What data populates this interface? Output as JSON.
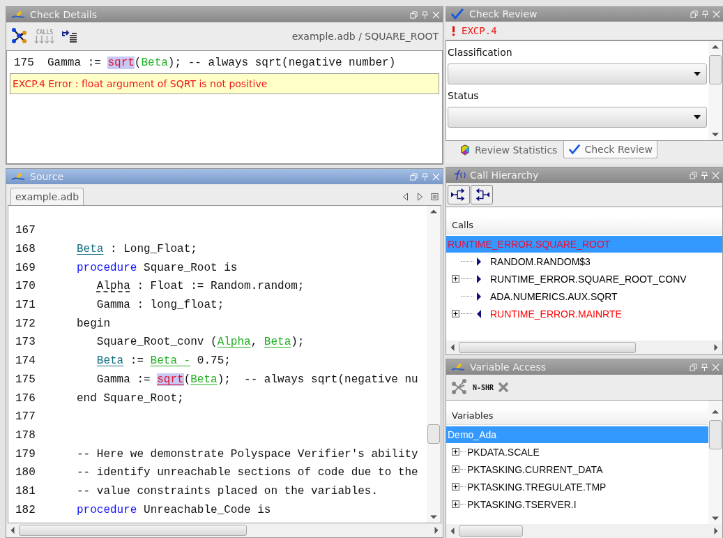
{
  "check_details": {
    "title": "Check Details",
    "active": false,
    "toolbar_label": "CALLS",
    "location": "example.adb / SQUARE_ROOT",
    "code_line": {
      "number": "175",
      "segments": [
        {
          "text": "Gamma := ",
          "kind": "plain"
        },
        {
          "text": "sqrt",
          "kind": "error"
        },
        {
          "text": "(",
          "kind": "plain"
        },
        {
          "text": "Beta",
          "kind": "used"
        },
        {
          "text": "); -- always sqrt(negative number)",
          "kind": "plain"
        }
      ]
    },
    "message": "EXCP.4 Error : float argument of SQRT is not positive"
  },
  "check_review": {
    "title": "Check Review",
    "active": false,
    "check": "EXCP.4",
    "fields": [
      {
        "label": "Classification"
      },
      {
        "label": "Status"
      }
    ],
    "tabs": [
      {
        "label": "Review Statistics",
        "selected": false,
        "kind": "stats"
      },
      {
        "label": "Check Review",
        "selected": true,
        "kind": "review"
      }
    ]
  },
  "source": {
    "title": "Source",
    "active": true,
    "tabs": [
      {
        "label": "example.adb",
        "selected": true
      }
    ],
    "lines": [
      {
        "number": "167"
      },
      {
        "number": "168",
        "segments": [
          {
            "text": "Beta",
            "kind": "declared"
          },
          {
            "text": " : Long_Float;",
            "kind": "plain"
          }
        ]
      },
      {
        "number": "169",
        "segments": [
          {
            "text": "procedure",
            "kind": "keyword"
          },
          {
            "text": " Square_Root is",
            "kind": "plain"
          }
        ]
      },
      {
        "number": "170",
        "indented": true,
        "segments": [
          {
            "text": "Alpha",
            "kind": "uninit"
          },
          {
            "text": " : Float := Random.random;",
            "kind": "plain"
          }
        ]
      },
      {
        "number": "171",
        "indented": true,
        "segments": [
          {
            "text": "Gamma : long_float;",
            "kind": "plain"
          }
        ]
      },
      {
        "number": "172",
        "segments": [
          {
            "text": "begin",
            "kind": "plain"
          }
        ]
      },
      {
        "number": "173",
        "indented": true,
        "segments": [
          {
            "text": "Square_Root_conv (",
            "kind": "plain"
          },
          {
            "text": "Alpha",
            "kind": "used"
          },
          {
            "text": ", ",
            "kind": "plain"
          },
          {
            "text": "Beta",
            "kind": "used"
          },
          {
            "text": ");",
            "kind": "plain"
          }
        ]
      },
      {
        "number": "174",
        "indented": true,
        "segments": [
          {
            "text": "Beta",
            "kind": "declared"
          },
          {
            "text": " := ",
            "kind": "plain"
          },
          {
            "text": "Beta -",
            "kind": "used"
          },
          {
            "text": " 0.75;",
            "kind": "plain"
          }
        ]
      },
      {
        "number": "175",
        "indented": true,
        "segments": [
          {
            "text": "Gamma := ",
            "kind": "plain"
          },
          {
            "text": "sqrt",
            "kind": "error"
          },
          {
            "text": "(",
            "kind": "plain"
          },
          {
            "text": "Beta",
            "kind": "used"
          },
          {
            "text": ");  -- always sqrt(negative nu",
            "kind": "plain"
          }
        ]
      },
      {
        "number": "176",
        "segments": [
          {
            "text": "end Square_Root;",
            "kind": "plain"
          }
        ]
      },
      {
        "number": "177"
      },
      {
        "number": "178"
      },
      {
        "number": "179",
        "segments": [
          {
            "text": "-- Here we demonstrate Polyspace Verifier's ability",
            "kind": "plain"
          }
        ]
      },
      {
        "number": "180",
        "segments": [
          {
            "text": "-- identify unreachable sections of code due to the",
            "kind": "plain"
          }
        ]
      },
      {
        "number": "181",
        "segments": [
          {
            "text": "-- value constraints placed on the variables.",
            "kind": "plain"
          }
        ]
      },
      {
        "number": "182",
        "segments": [
          {
            "text": "procedure",
            "kind": "keyword"
          },
          {
            "text": " Unreachable_Code is",
            "kind": "plain"
          }
        ]
      }
    ]
  },
  "call_hierarchy": {
    "title": "Call Hierarchy",
    "active": false,
    "column": "Calls",
    "root": {
      "label": "RUNTIME_ERROR.SQUARE_ROOT",
      "selected": true,
      "color": "#e8103c",
      "children": [
        {
          "label": "RANDOM.RANDOM$3",
          "has_children": false,
          "kind": "callee",
          "color": "#000000"
        },
        {
          "label": "RUNTIME_ERROR.SQUARE_ROOT_CONV",
          "has_children": true,
          "kind": "callee",
          "color": "#000000"
        },
        {
          "label": "ADA.NUMERICS.AUX.SQRT",
          "has_children": false,
          "kind": "callee",
          "color": "#000000"
        },
        {
          "label": "RUNTIME_ERROR.MAINRTE",
          "has_children": true,
          "kind": "caller",
          "color": "#ff0000"
        }
      ]
    }
  },
  "variable_access": {
    "title": "Variable Access",
    "active": false,
    "toolbar_label": "N-SHR",
    "column": "Variables",
    "root": {
      "label": "Demo_Ada",
      "selected": true,
      "children": [
        {
          "label": "PKDATA.SCALE",
          "has_children": true
        },
        {
          "label": "PKTASKING.CURRENT_DATA",
          "has_children": true
        },
        {
          "label": "PKTASKING.TREGULATE.TMP",
          "has_children": true
        },
        {
          "label": "PKTASKING.TSERVER.I",
          "has_children": true
        }
      ]
    }
  }
}
